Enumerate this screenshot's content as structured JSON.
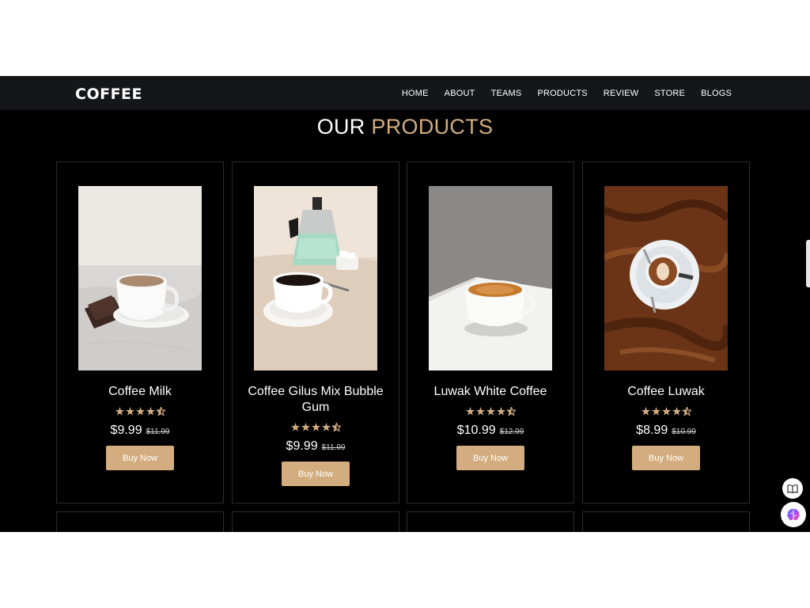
{
  "brand": {
    "logo_text": "COFFEE"
  },
  "nav": {
    "items": [
      {
        "label": "HOME"
      },
      {
        "label": "ABOUT"
      },
      {
        "label": "TEAMS"
      },
      {
        "label": "PRODUCTS"
      },
      {
        "label": "REVIEW"
      },
      {
        "label": "STORE"
      },
      {
        "label": "BLOGS"
      }
    ]
  },
  "section": {
    "title_prefix": "OUR",
    "title_accent": "PRODUCTS"
  },
  "colors": {
    "accent": "#d3ad7f",
    "background": "#000000",
    "navbar": "#15161a"
  },
  "products": [
    {
      "name": "Coffee Milk",
      "rating": 4.5,
      "price": "$9.99",
      "old_price": "$11.99",
      "button_label": "Buy Now",
      "image": "cup-of-milk-coffee-on-marble-with-chocolate"
    },
    {
      "name": "Coffee Gilus Mix Bubble Gum",
      "rating": 4.5,
      "price": "$9.99",
      "old_price": "$11.99",
      "button_label": "Buy Now",
      "image": "mint-moka-pot-and-black-coffee-cup"
    },
    {
      "name": "Luwak White Coffee",
      "rating": 4.5,
      "price": "$10.99",
      "old_price": "$12.99",
      "button_label": "Buy Now",
      "image": "espresso-cup-on-white-table"
    },
    {
      "name": "Coffee Luwak",
      "rating": 4.5,
      "price": "$8.99",
      "old_price": "$10.99",
      "button_label": "Buy Now",
      "image": "latte-art-cup-on-wooden-table"
    }
  ],
  "floating": {
    "reader_icon": "book-icon",
    "assistant_icon": "brain-icon"
  }
}
